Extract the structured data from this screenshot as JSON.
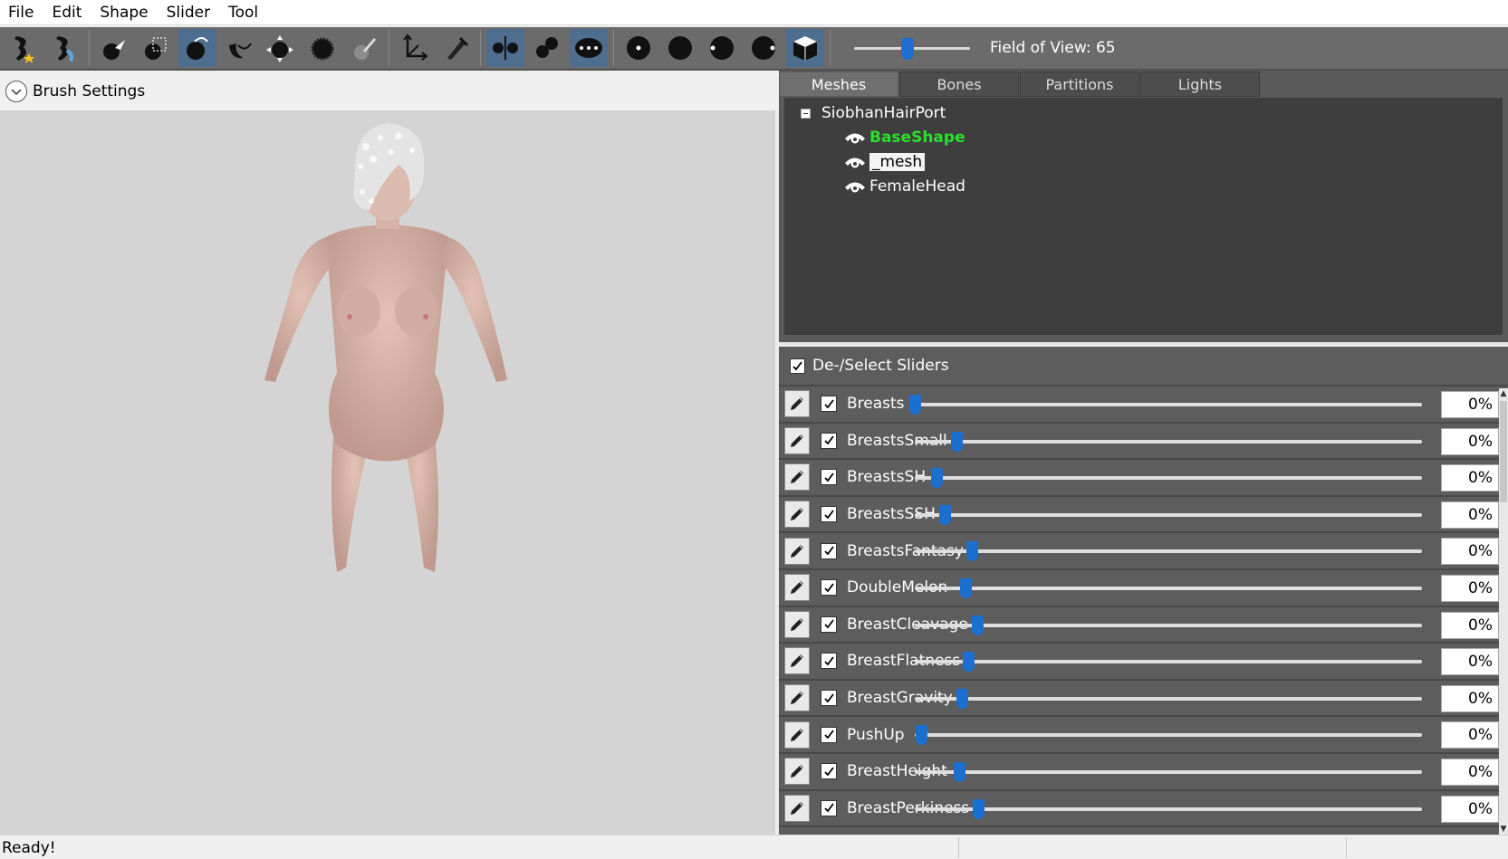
{
  "menu": {
    "items": [
      "File",
      "Edit",
      "Shape",
      "Slider",
      "Tool"
    ]
  },
  "toolbar": {
    "tools": [
      {
        "icon": "new-project-icon",
        "active": false
      },
      {
        "icon": "load-outfit-icon",
        "active": false
      },
      {
        "icon": "select-brush-icon",
        "active": false
      },
      {
        "icon": "mask-brush-icon",
        "active": false
      },
      {
        "icon": "inflate-brush-icon",
        "active": true
      },
      {
        "icon": "deflate-brush-icon",
        "active": false
      },
      {
        "icon": "move-brush-icon",
        "active": false
      },
      {
        "icon": "smooth-brush-icon",
        "active": false
      },
      {
        "icon": "weight-brush-icon",
        "active": false
      },
      {
        "icon": "transform-icon",
        "active": false
      },
      {
        "icon": "pivot-icon",
        "active": false
      },
      {
        "icon": "x-mirror-icon",
        "active": true
      },
      {
        "icon": "connected-only-icon",
        "active": false
      },
      {
        "icon": "global-brush-icon",
        "active": true
      },
      {
        "icon": "front-view-icon",
        "active": false
      },
      {
        "icon": "back-view-icon",
        "active": false
      },
      {
        "icon": "left-view-icon",
        "active": false
      },
      {
        "icon": "right-view-icon",
        "active": false
      },
      {
        "icon": "perspective-cube-icon",
        "active": true
      }
    ],
    "fov_label": "Field of View: 65",
    "fov_value": 65,
    "fov_fraction": 0.46
  },
  "brush_settings": {
    "label": "Brush Settings"
  },
  "tabs": [
    {
      "label": "Meshes",
      "active": true
    },
    {
      "label": "Bones",
      "active": false
    },
    {
      "label": "Partitions",
      "active": false
    },
    {
      "label": "Lights",
      "active": false
    }
  ],
  "tree": {
    "root": "SiobhanHairPort",
    "nodes": [
      {
        "label": "BaseShape",
        "state": "active"
      },
      {
        "label": "_mesh",
        "state": "selected"
      },
      {
        "label": "FemaleHead",
        "state": "normal"
      }
    ]
  },
  "sliders_header": {
    "label": "De-/Select Sliders",
    "checked": true
  },
  "sliders": [
    {
      "name": "Breasts",
      "value": "0%",
      "pos": 0.0
    },
    {
      "name": "BreastsSmall",
      "value": "0%",
      "pos": 0.082
    },
    {
      "name": "BreastsSH",
      "value": "0%",
      "pos": 0.043
    },
    {
      "name": "BreastsSSH",
      "value": "0%",
      "pos": 0.059
    },
    {
      "name": "BreastsFantasy",
      "value": "0%",
      "pos": 0.113
    },
    {
      "name": "DoubleMelon",
      "value": "0%",
      "pos": 0.1
    },
    {
      "name": "BreastCleavage",
      "value": "0%",
      "pos": 0.123
    },
    {
      "name": "BreastFlatness",
      "value": "0%",
      "pos": 0.106
    },
    {
      "name": "BreastGravity",
      "value": "0%",
      "pos": 0.092
    },
    {
      "name": "PushUp",
      "value": "0%",
      "pos": 0.012
    },
    {
      "name": "BreastHeight",
      "value": "0%",
      "pos": 0.088
    },
    {
      "name": "BreastPerkiness",
      "value": "0%",
      "pos": 0.125
    }
  ],
  "status": {
    "text": "Ready!"
  },
  "colors": {
    "accent": "#1a6fd1",
    "active_mesh": "#2adf2a",
    "toolbar_bg": "#6b6b6b",
    "panel_bg": "#5d5d5d"
  }
}
